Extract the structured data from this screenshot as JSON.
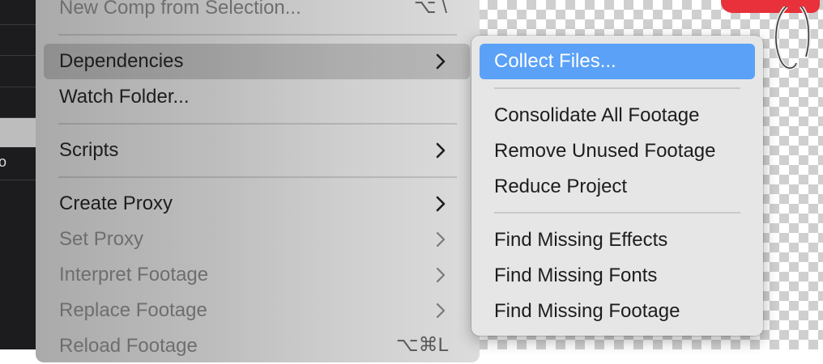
{
  "main_menu": {
    "items": [
      {
        "label": "New Comp from Selection...",
        "shortcut": "⌥ \\"
      },
      {
        "label": "Dependencies"
      },
      {
        "label": "Watch Folder..."
      },
      {
        "label": "Scripts"
      },
      {
        "label": "Create Proxy"
      },
      {
        "label": "Set Proxy"
      },
      {
        "label": "Interpret Footage"
      },
      {
        "label": "Replace Footage"
      },
      {
        "label": "Reload Footage",
        "shortcut": "⌥⌘L"
      }
    ]
  },
  "submenu": {
    "items": [
      {
        "label": "Collect Files..."
      },
      {
        "label": "Consolidate All Footage"
      },
      {
        "label": "Remove Unused Footage"
      },
      {
        "label": "Reduce Project"
      },
      {
        "label": "Find Missing Effects"
      },
      {
        "label": "Find Missing Fonts"
      },
      {
        "label": "Find Missing Footage"
      }
    ]
  },
  "left_panel": {
    "glyph": "o"
  },
  "colors": {
    "highlight": "#5aa1f7",
    "brand_red": "#e8313a"
  },
  "icons": {
    "submenu_arrow": "chevron-right-icon"
  }
}
